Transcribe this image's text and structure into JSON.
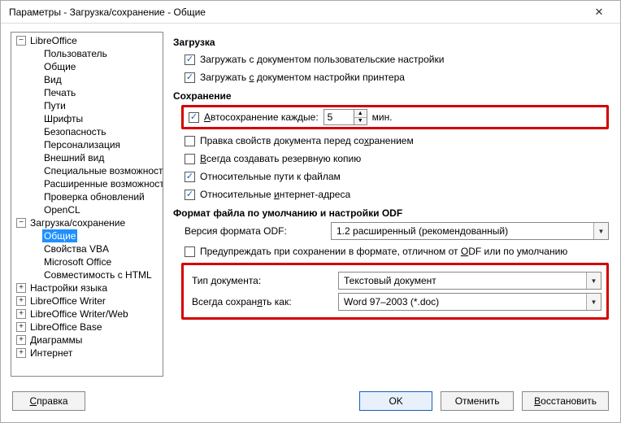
{
  "window": {
    "title": "Параметры - Загрузка/сохранение - Общие"
  },
  "tree": {
    "libreoffice": {
      "label": "LibreOffice",
      "expanded": true
    },
    "lo_items": [
      "Пользователь",
      "Общие",
      "Вид",
      "Печать",
      "Пути",
      "Шрифты",
      "Безопасность",
      "Персонализация",
      "Внешний вид",
      "Специальные возможности",
      "Расширенные возможности",
      "Проверка обновлений",
      "OpenCL"
    ],
    "load_save": {
      "label": "Загрузка/сохранение",
      "expanded": true
    },
    "ls_items": [
      "Общие",
      "Свойства VBA",
      "Microsoft Office",
      "Совместимость с HTML"
    ],
    "others": [
      "Настройки языка",
      "LibreOffice Writer",
      "LibreOffice Writer/Web",
      "LibreOffice Base",
      "Диаграммы",
      "Интернет"
    ]
  },
  "panel": {
    "load_h": "Загрузка",
    "load_user": "Загружать с документом пользовательские настройки",
    "load_printer_pre": "Загружать ",
    "load_printer_u": "с",
    "load_printer_post": " документом настройки принтера",
    "save_h": "Сохранение",
    "autosave_u": "А",
    "autosave_post": "втосохранение каждые:",
    "autosave_value": "5",
    "autosave_unit": "мин.",
    "edit_props_pre": "Правка свойств документа перед со",
    "edit_props_u": "х",
    "edit_props_post": "ранением",
    "backup_u": "В",
    "backup_post": "сегда создавать резервную копию",
    "relpaths": "Относительные пути к файлам",
    "relurls_pre": "Относительные ",
    "relurls_u": "и",
    "relurls_post": "нтернет-адреса",
    "fmt_h": "Формат файла по умолчанию и настройки ODF",
    "odf_label": "Версия формата ODF:",
    "odf_value": "1.2 расширенный (рекомендованный)",
    "warn_pre": "Предупреждать при сохранении в формате, отличном от ",
    "warn_u": "O",
    "warn_post": "DF или по умолчанию",
    "doctype_label": "Тип документа:",
    "doctype_value": "Текстовый документ",
    "always_pre": "Всегда сохран",
    "always_u": "я",
    "always_post": "ть как:",
    "always_value": "Word 97–2003 (*.doc)"
  },
  "buttons": {
    "help_u": "С",
    "help_post": "правка",
    "ok": "OK",
    "cancel": "Отменить",
    "restore_u": "В",
    "restore_post": "осстановить"
  }
}
